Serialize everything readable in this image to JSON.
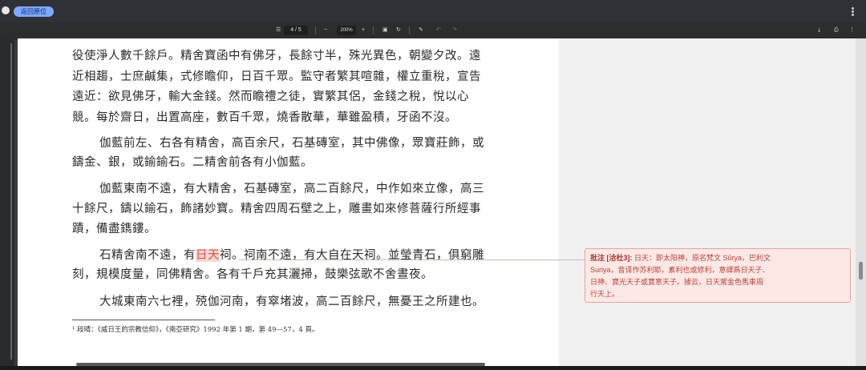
{
  "app": {
    "pill_label": "返回原位",
    "page_indicator": "4 / 5",
    "zoom": "200%"
  },
  "document": {
    "lines": [
      "役使淨人數千餘戶。精舍寶函中有佛牙，長餘寸半，殊光異色，朝變夕改。遠",
      "近相趨，士庶鹹集，式修瞻仰，日百千眾。監守者繁其喧雜，權立重稅，宣告",
      "遠近：欲見佛牙，輸大金錢。然而瞻禮之徒，實繁其侶，金錢之稅，悅以心",
      "競。每於齋日，出置高座，數百千眾，燒香散華，華雖盈積，牙函不沒。",
      "伽藍前左、右各有精舍，高百余尺，石基磚室，其中佛像，眾寶莊飾，或",
      "鑄金、銀，或鍮鍮石。二精舍前各有小伽藍。",
      "伽藍東南不遠，有大精舍，石基磚室，高二百餘尺，中作如來立像，高三",
      "十餘尺，鑄以鍮石，飾諸妙寶。精舍四周石壁之上，雕畫如來修菩薩行所經事",
      "蹟，備盡鐫鏤。",
      {
        "before": "石精舍南不遠，有",
        "highlight": "日天",
        "after": "祠。祠南不遠，有大自在天祠。並瑩青石，俱窮雕"
      },
      "刻，規模度量，同佛精舍。各有千戶充其灑掃，鼓樂弦歌不舍晝夜。",
      "大城東南六七裡，殑伽河南，有窣堵波，高二百餘尺，無憂王之所建也。"
    ],
    "footnote": "¹ 段晴：《威日王的宗教信仰》，《南亞研究》1992 年第 1 期，第 49—57，4 頁。"
  },
  "annotation": {
    "title": "批注 [洽杜3]:",
    "line1": " 日天：即太阳神，原名梵文 Sūrya，巴利文",
    "line2": "Suriya，音译作苏利耶，素利也或修利，意譯爲日天子、",
    "line3": "日神、寶光天子或寶意天子。據云，日天駕金色馬車周",
    "line4": "行天上。"
  },
  "colors": {
    "highlight": "#f7d6d3",
    "comment_bg": "#fde8e6",
    "comment_border": "#e6a49c",
    "accent": "#7fa8ff"
  }
}
